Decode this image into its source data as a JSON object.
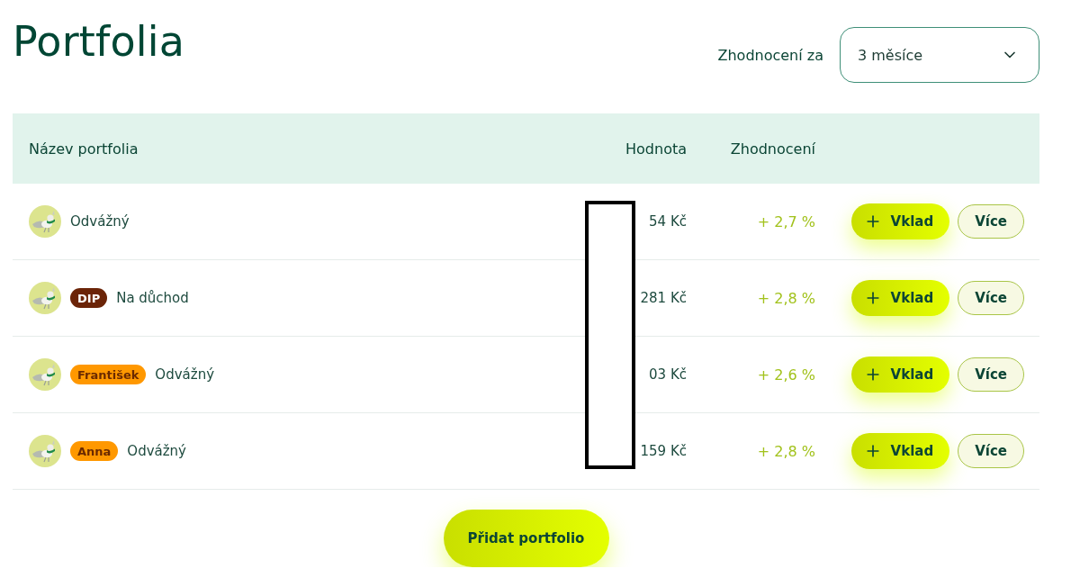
{
  "title": "Portfolia",
  "period_filter": {
    "label": "Zhodnocení za",
    "value": "3 měsíce"
  },
  "table": {
    "columns": [
      "Název portfolia",
      "Hodnota",
      "Zhodnocení"
    ],
    "rows": [
      {
        "name": "Odvážný",
        "value": "54 Kč",
        "return": "+ 2,7 %",
        "actions": [
          {
            "kind": "deposit",
            "label": "Vklad"
          },
          {
            "kind": "more",
            "label": "Více"
          }
        ]
      },
      {
        "badge": {
          "text": "DIP",
          "color": "#6b2408"
        },
        "name": "Na důchod",
        "value": "281 Kč",
        "return": "+ 2,8 %",
        "actions": [
          {
            "kind": "deposit",
            "label": "Vklad"
          },
          {
            "kind": "more",
            "label": "Více"
          }
        ]
      },
      {
        "badge": {
          "text": "František",
          "color": "#ff9800"
        },
        "name": "Odvážný",
        "value": "03 Kč",
        "return": "+ 2,6 %",
        "actions": [
          {
            "kind": "deposit",
            "label": "Vklad"
          },
          {
            "kind": "more",
            "label": "Více"
          }
        ]
      },
      {
        "badge": {
          "text": "Anna",
          "color": "#ff9800"
        },
        "name": "Odvážný",
        "value": "159 Kč",
        "return": "+ 2,8 %",
        "actions": [
          {
            "kind": "deposit",
            "label": "Vklad"
          },
          {
            "kind": "more",
            "label": "Více"
          }
        ]
      }
    ]
  },
  "add_button": "Přidat portfolio"
}
